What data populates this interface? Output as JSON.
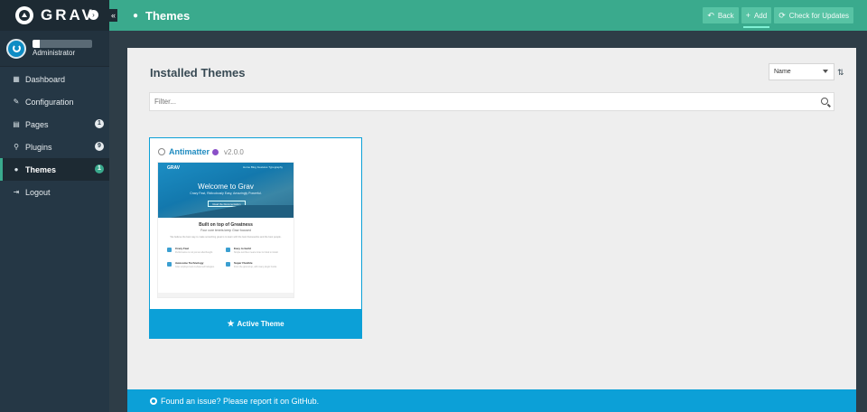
{
  "brand": {
    "name": "GRAV",
    "collapse_symbol": "«",
    "menu_symbol": "›"
  },
  "user": {
    "name_initial": "A",
    "role": "Administrator"
  },
  "sidebar": {
    "items": [
      {
        "label": "Dashboard",
        "icon": "th-icon",
        "glyph": "▦",
        "badge": ""
      },
      {
        "label": "Configuration",
        "icon": "wrench-icon",
        "glyph": "🔧",
        "badge": ""
      },
      {
        "label": "Pages",
        "icon": "file-icon",
        "glyph": "▤",
        "badge": "1"
      },
      {
        "label": "Plugins",
        "icon": "plug-icon",
        "glyph": "⚡",
        "badge": "9"
      },
      {
        "label": "Themes",
        "icon": "tint-icon",
        "glyph": "●",
        "badge": "1",
        "active": true
      },
      {
        "label": "Logout",
        "icon": "sign-out-icon",
        "glyph": "⇥",
        "badge": ""
      }
    ]
  },
  "header": {
    "title": "Themes",
    "icon": "tint-icon",
    "buttons": {
      "back": "Back",
      "add": "Add",
      "check_updates": "Check for Updates"
    }
  },
  "main": {
    "section_title": "Installed Themes",
    "sort_value": "Name",
    "filter_placeholder": "Filter..."
  },
  "theme": {
    "name": "Antimatter",
    "version": "v2.0.0",
    "status": "Active Theme",
    "preview": {
      "brand": "GRAV",
      "menu": "Home   Blog   Features   Typography",
      "hero_title": "Welcome to Grav",
      "hero_sub": "Crazy Fast, Ridiculously Easy, Amazingly Powerful.",
      "hero_button": "Read the Documentation",
      "h2": "Built on top of Greatness",
      "h3": "Four core tenets keep Grav focused",
      "text": "We believe the best way to make something great is to learn with the best frameworks and the best people.",
      "features": [
        {
          "title": "Crazy Fast",
          "text": "Performance is not just an afterthought."
        },
        {
          "title": "Easy to build",
          "text": "Simple text files means Grav is trivial to install."
        },
        {
          "title": "Awesome Technology",
          "text": "Grav employs best-in-class technologies."
        },
        {
          "title": "Super Flexible",
          "text": "From the ground up, with many plugin hooks."
        }
      ]
    }
  },
  "footer": {
    "text": "Found an issue? Please report it on GitHub."
  },
  "colors": {
    "accent": "#3aaa8d",
    "sidebar": "#253745",
    "info": "#0ca0d7",
    "page_bg": "#eeeeee"
  }
}
